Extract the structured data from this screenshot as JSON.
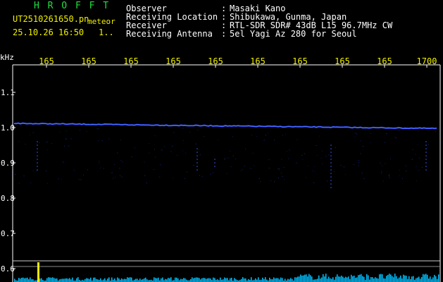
{
  "header": {
    "brand": "H R O F F T",
    "filename": "UT2510261650.pn",
    "mode": "meteor",
    "datetime": "25.10.26 16:50",
    "counter": "1.."
  },
  "info": {
    "rows": [
      {
        "label": "Observer",
        "sep": ":",
        "value": "Masaki Kano"
      },
      {
        "label": "Receiving Location",
        "sep": ":",
        "value": "Shibukawa, Gunma, Japan"
      },
      {
        "label": "Receiver",
        "sep": ":",
        "value": "RTL-SDR SDR# 43dB L15 96.7MHz CW"
      },
      {
        "label": "Receiving Antenna",
        "sep": ":",
        "value": "5el Yagi Az 280 for Seoul"
      }
    ]
  },
  "plot": {
    "y_unit": "kHz",
    "y_ticks": [
      "1.1",
      "1.0",
      "0.9",
      "0.8",
      "0.7",
      "0.6"
    ],
    "x_ticks": [
      "165",
      "165",
      "165",
      "165",
      "165",
      "165",
      "165",
      "165",
      "165",
      "1700"
    ],
    "colors": {
      "axis": "#ffffff",
      "tick_text": "#f0f000",
      "signal": "#3050ff",
      "spectrum": "#00c0ff",
      "spike": "#f0f000"
    }
  }
}
